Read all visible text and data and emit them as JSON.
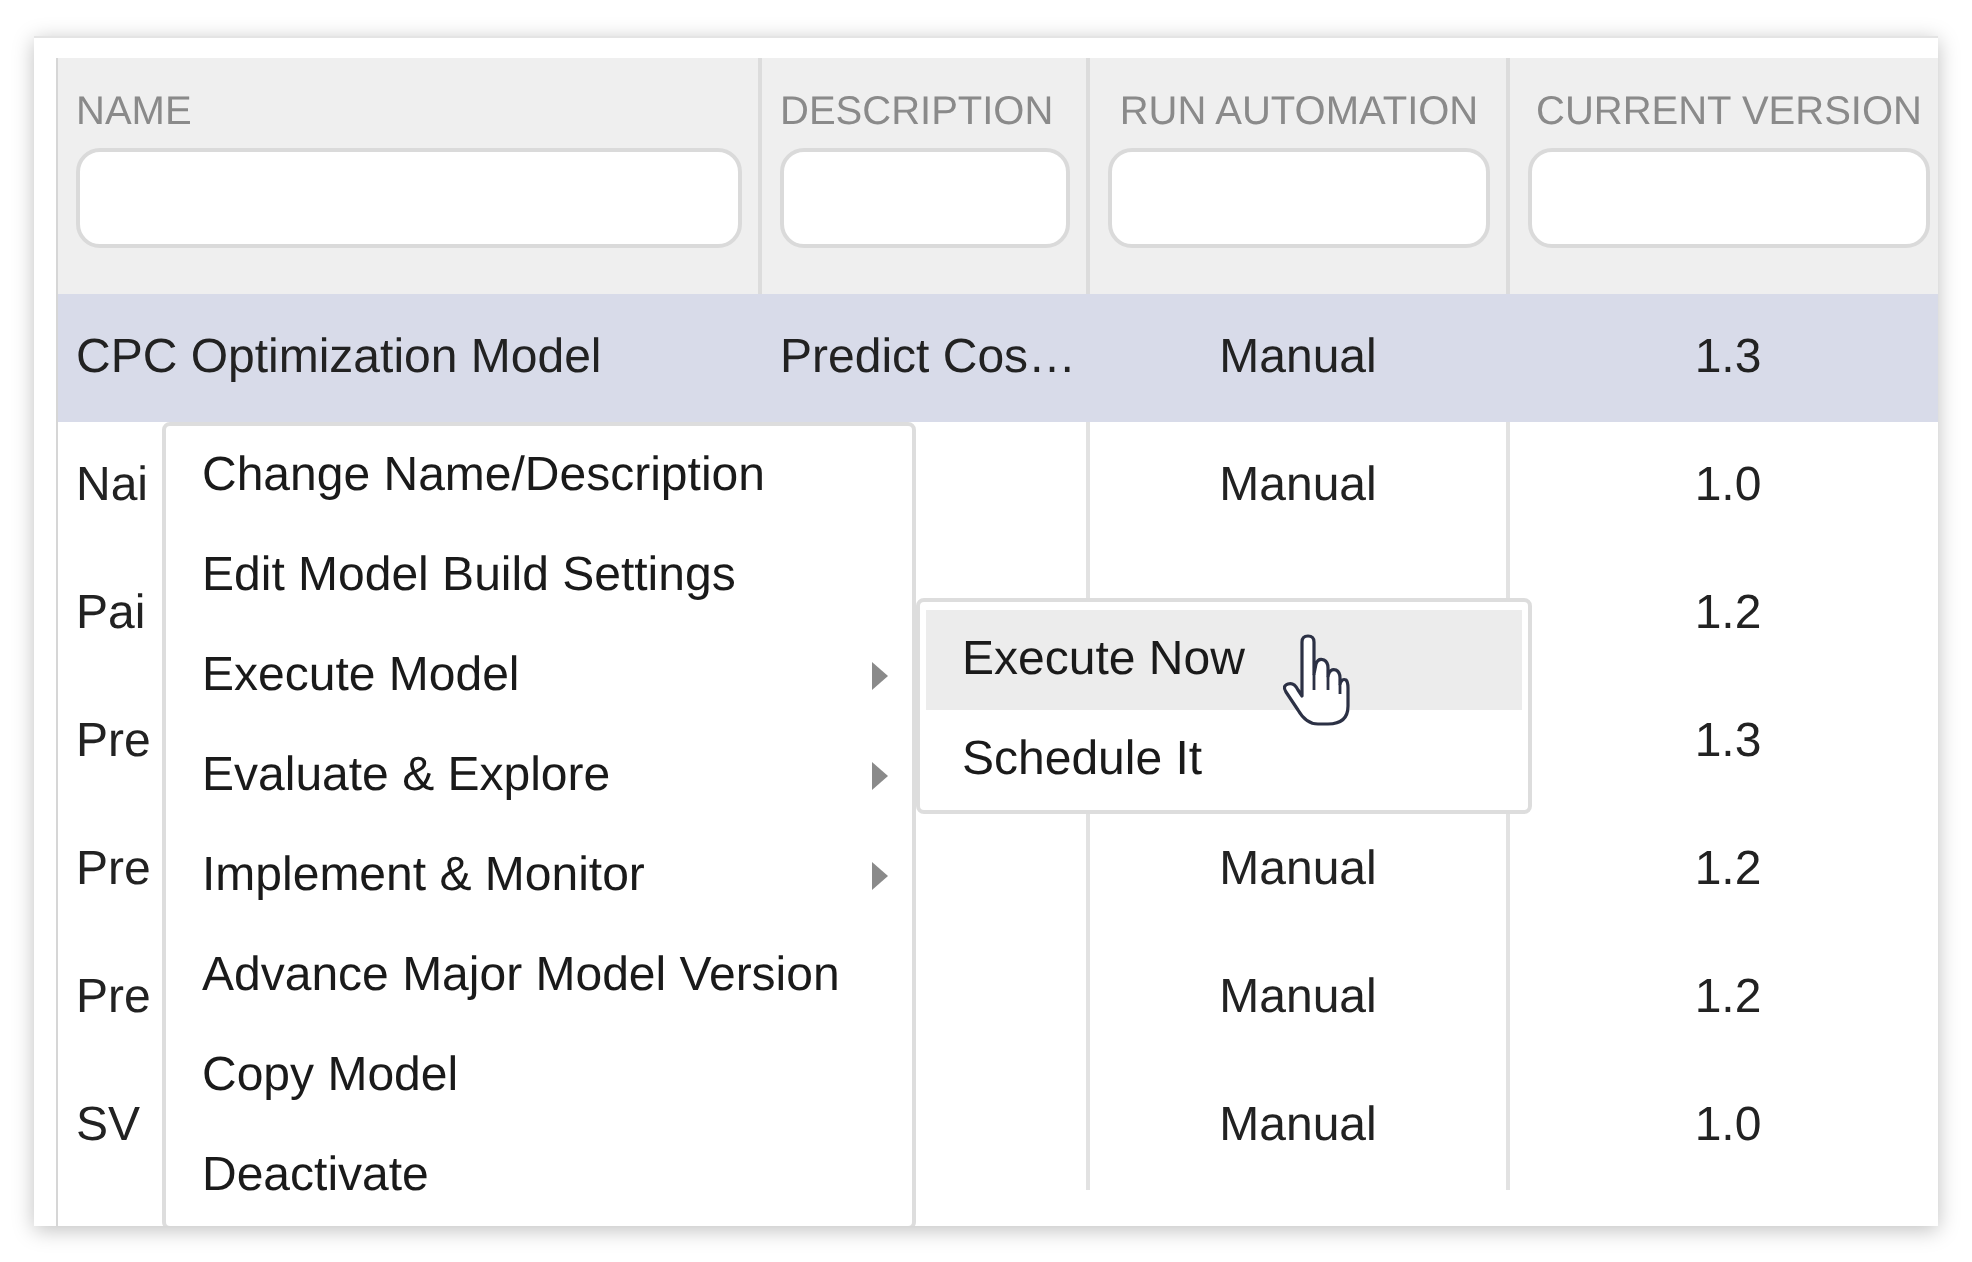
{
  "table": {
    "columns": [
      {
        "label": "NAME"
      },
      {
        "label": "DESCRIPTION"
      },
      {
        "label": "RUN AUTOMATION"
      },
      {
        "label": "CURRENT VERSION"
      }
    ],
    "rows": [
      {
        "selected": true,
        "cells": [
          "CPC Optimization Model",
          "Predict Cos…",
          "Manual",
          "1.3"
        ]
      },
      {
        "selected": false,
        "cells": [
          "Nai",
          "",
          "Manual",
          "1.0"
        ]
      },
      {
        "selected": false,
        "cells": [
          "Pai",
          "",
          "",
          "1.2"
        ]
      },
      {
        "selected": false,
        "cells": [
          "Pre",
          "",
          "",
          "1.3"
        ]
      },
      {
        "selected": false,
        "cells": [
          "Pre",
          "",
          "Manual",
          "1.2"
        ]
      },
      {
        "selected": false,
        "cells": [
          "Pre",
          "",
          "Manual",
          "1.2"
        ]
      },
      {
        "selected": false,
        "cells": [
          "SV",
          "",
          "Manual",
          "1.0"
        ]
      }
    ]
  },
  "context_menu": {
    "items": [
      {
        "label": "Change Name/Description",
        "has_submenu": false
      },
      {
        "label": "Edit Model Build Settings",
        "has_submenu": false
      },
      {
        "label": "Execute Model",
        "has_submenu": true
      },
      {
        "label": "Evaluate & Explore",
        "has_submenu": true
      },
      {
        "label": "Implement & Monitor",
        "has_submenu": true
      },
      {
        "label": "Advance Major Model Version",
        "has_submenu": false
      },
      {
        "label": "Copy Model",
        "has_submenu": false
      },
      {
        "label": "Deactivate",
        "has_submenu": false
      }
    ]
  },
  "submenu": {
    "items": [
      {
        "label": "Execute Now",
        "selected": true
      },
      {
        "label": "Schedule It",
        "selected": false
      }
    ]
  }
}
